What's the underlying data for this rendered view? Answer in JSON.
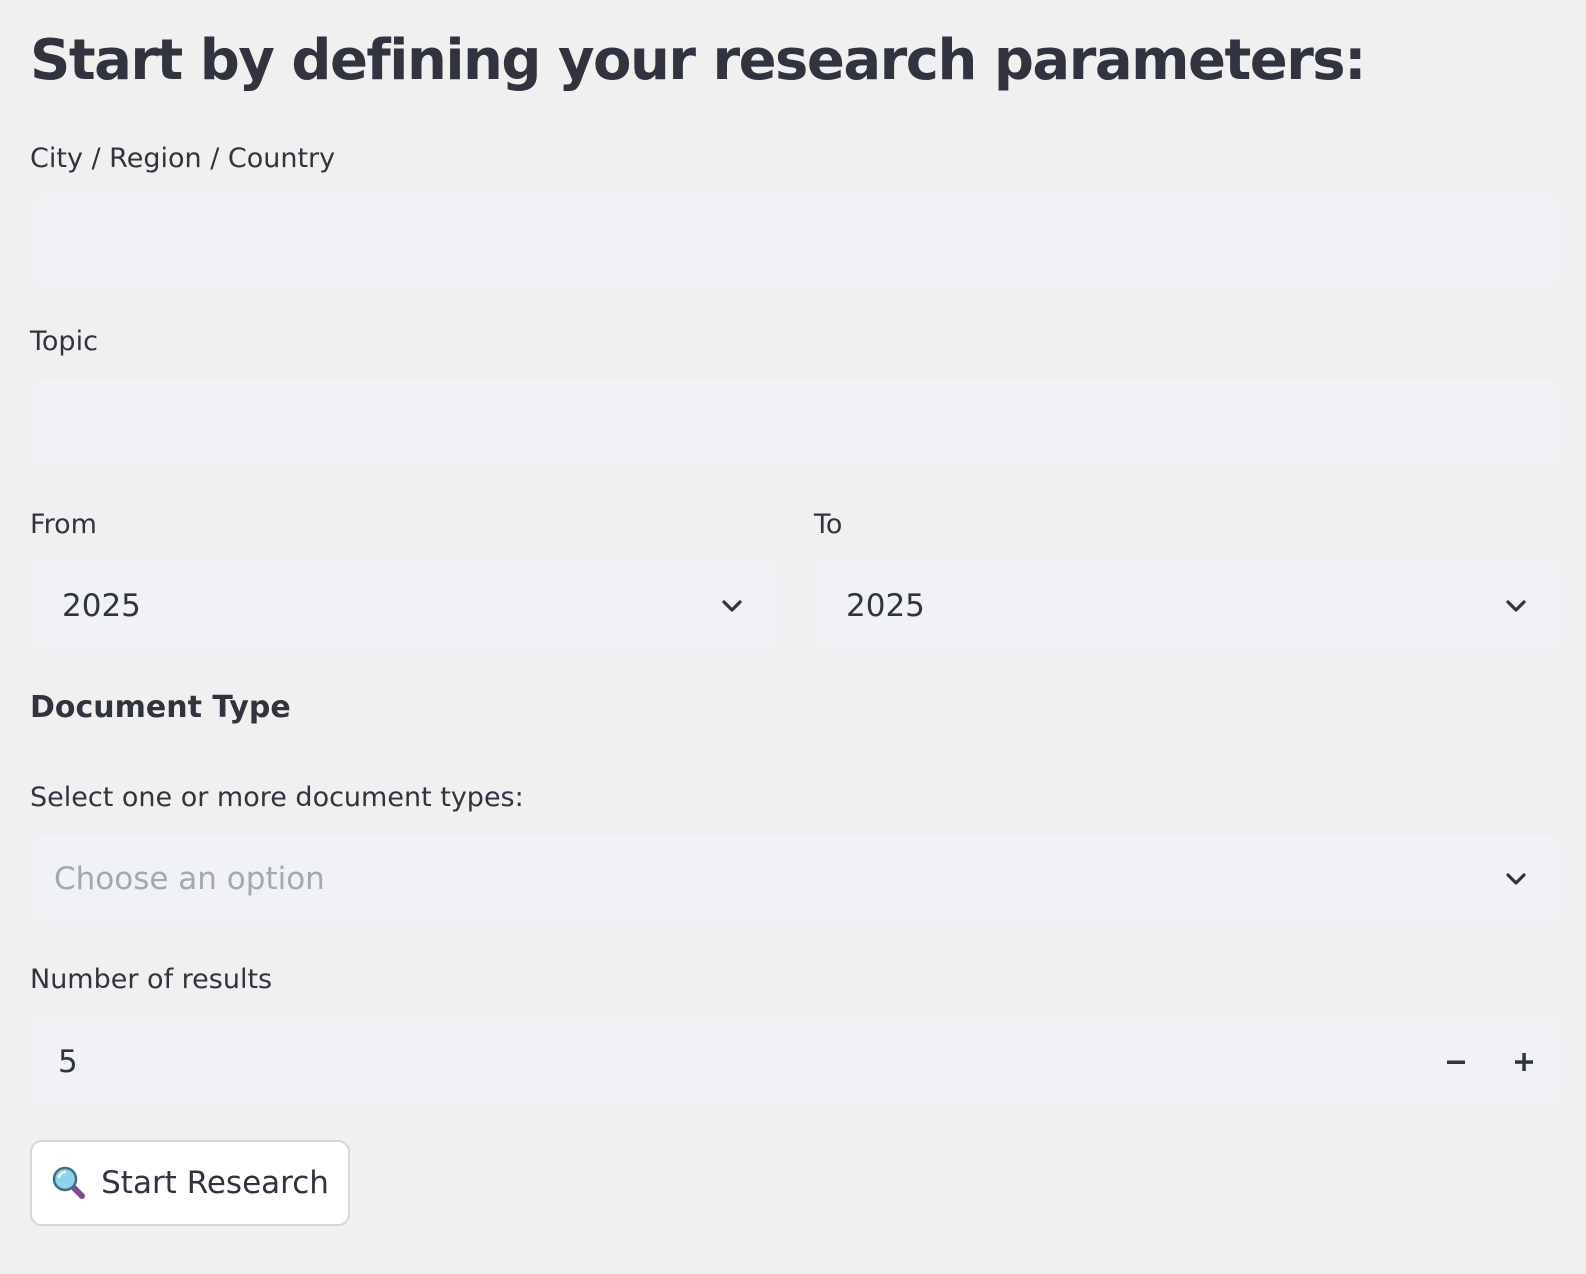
{
  "form": {
    "heading": "Start by defining your research parameters:",
    "location": {
      "label": "City / Region / Country",
      "value": "",
      "placeholder": ""
    },
    "topic": {
      "label": "Topic",
      "value": "",
      "placeholder": ""
    },
    "from": {
      "label": "From",
      "selected": "2025"
    },
    "to": {
      "label": "To",
      "selected": "2025"
    },
    "document_type": {
      "section_title": "Document Type",
      "label": "Select one or more document types:",
      "placeholder": "Choose an option"
    },
    "results": {
      "label": "Number of results",
      "value": "5"
    },
    "submit": {
      "label": "Start Research",
      "icon": "magnifying-glass-icon"
    }
  },
  "colors": {
    "background": "#f0f0f0",
    "field_background": "#f0f2f6",
    "text": "#31333f",
    "placeholder": "#a3a8b4",
    "button_background": "#ffffff",
    "button_border": "#d6d6d9"
  },
  "icons": {
    "select_chevron": "chevron-down-icon",
    "decrement": "minus-icon",
    "increment": "plus-icon"
  }
}
